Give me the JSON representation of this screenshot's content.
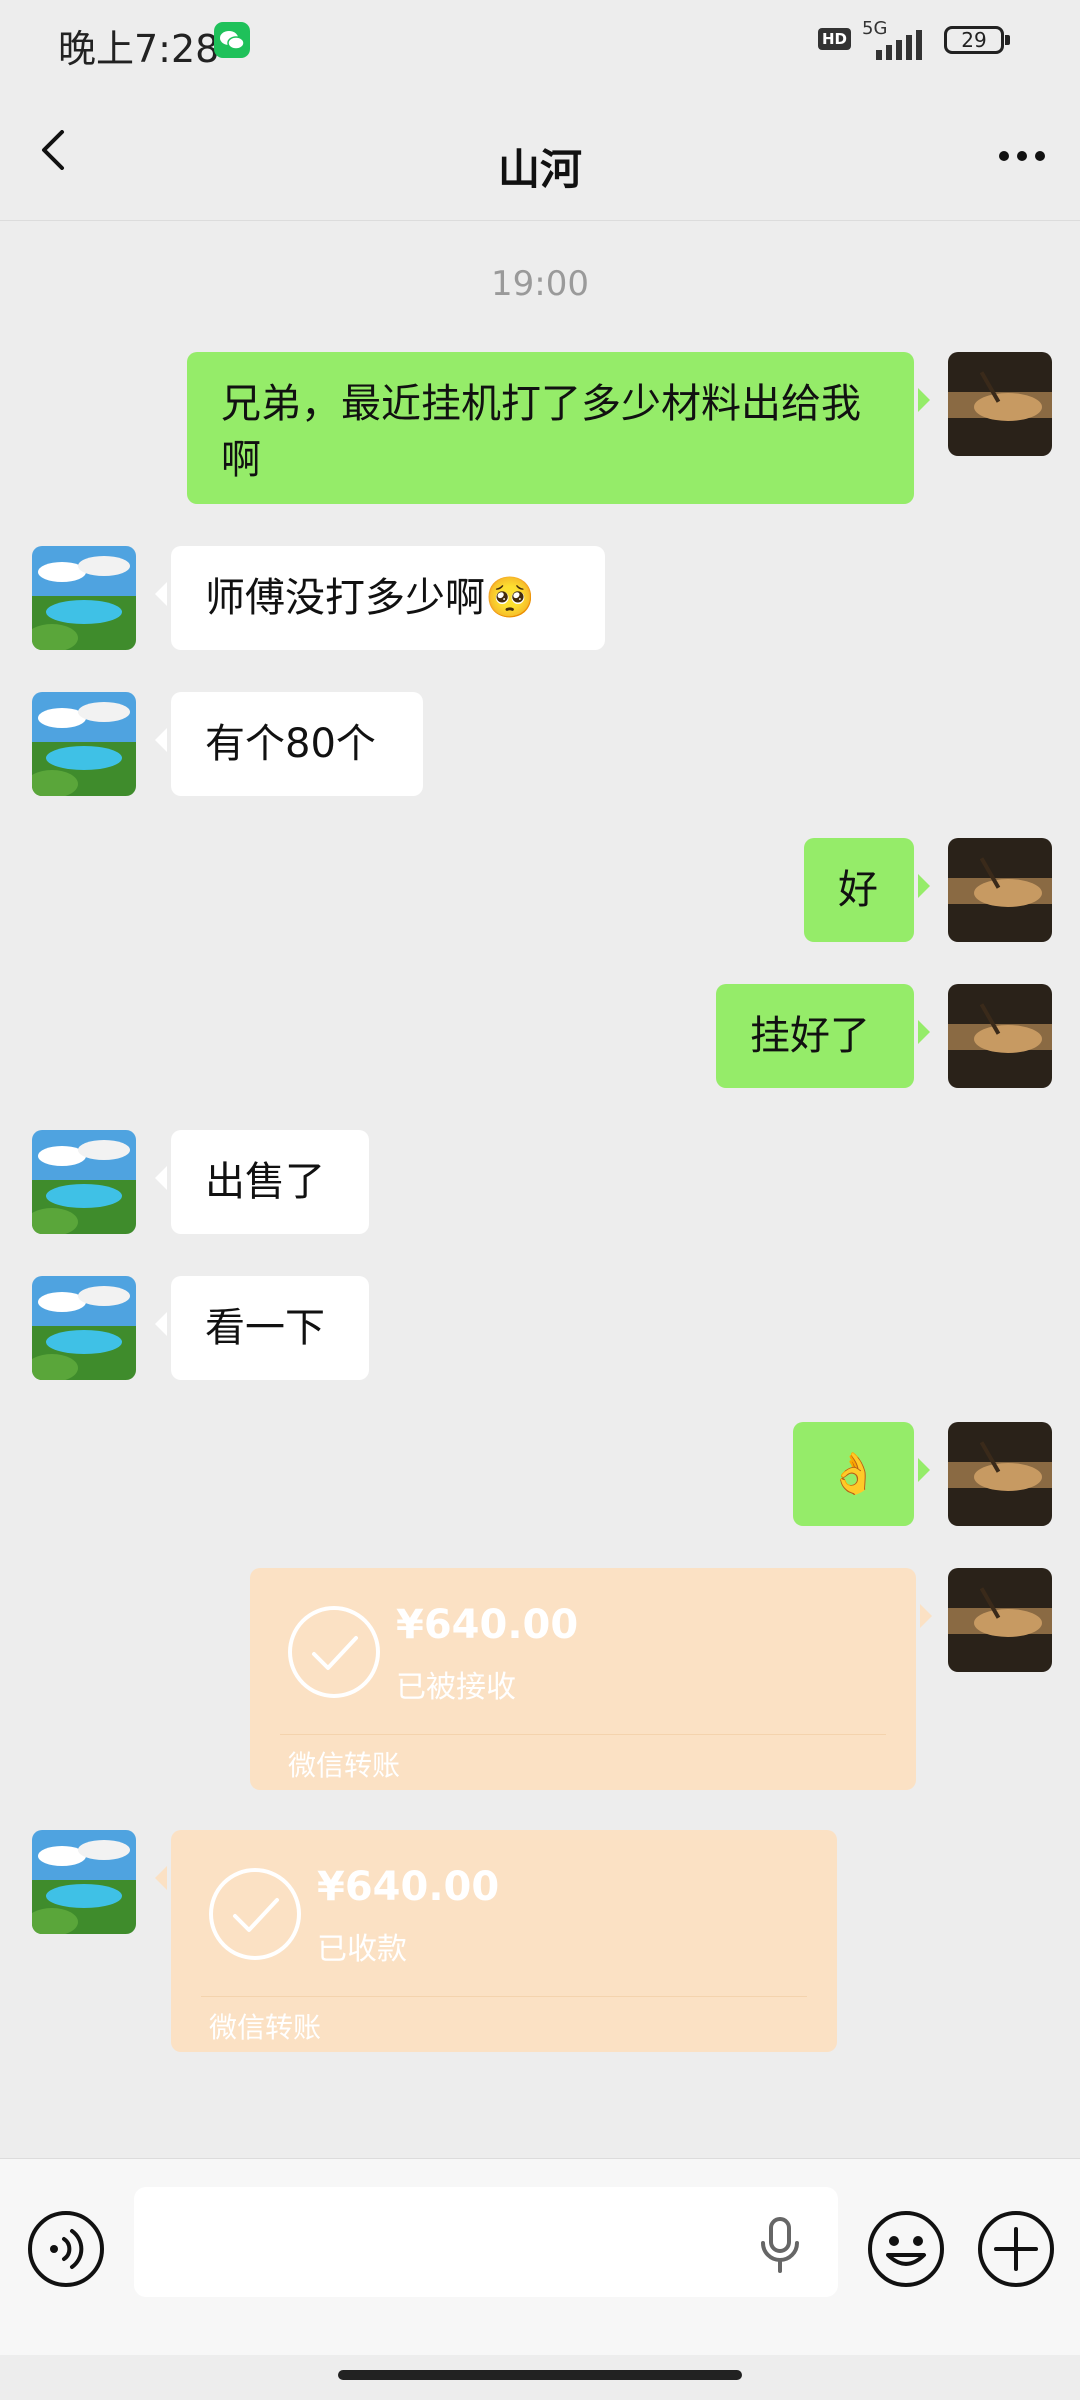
{
  "status_bar": {
    "time": "晚上7:28",
    "network": "5G",
    "hd_label": "HD",
    "battery": "29"
  },
  "header": {
    "title": "山河"
  },
  "chat": {
    "timestamp": "19:00",
    "messages": [
      {
        "side": "out",
        "text": "兄弟，最近挂机打了多少材料出给我啊"
      },
      {
        "side": "in",
        "text": "师傅没打多少啊🥺"
      },
      {
        "side": "in",
        "text": "有个80个"
      },
      {
        "side": "out",
        "text": "好"
      },
      {
        "side": "out",
        "text": "挂好了"
      },
      {
        "side": "in",
        "text": "出售了"
      },
      {
        "side": "in",
        "text": "看一下"
      },
      {
        "side": "out",
        "text": "👌"
      }
    ],
    "transfers": [
      {
        "side": "out",
        "amount": "¥640.00",
        "status": "已被接收",
        "label": "微信转账"
      },
      {
        "side": "in",
        "amount": "¥640.00",
        "status": "已收款",
        "label": "微信转账"
      }
    ]
  },
  "input_bar": {
    "placeholder": ""
  },
  "colors": {
    "outgoing_bubble": "#95ec69",
    "incoming_bubble": "#ffffff",
    "transfer_card": "#fbe1c4",
    "background": "#ededed"
  },
  "icons": [
    "back-arrow-icon",
    "more-icon",
    "voice-icon",
    "mic-icon",
    "emoji-icon",
    "plus-icon",
    "checkmark-icon"
  ]
}
